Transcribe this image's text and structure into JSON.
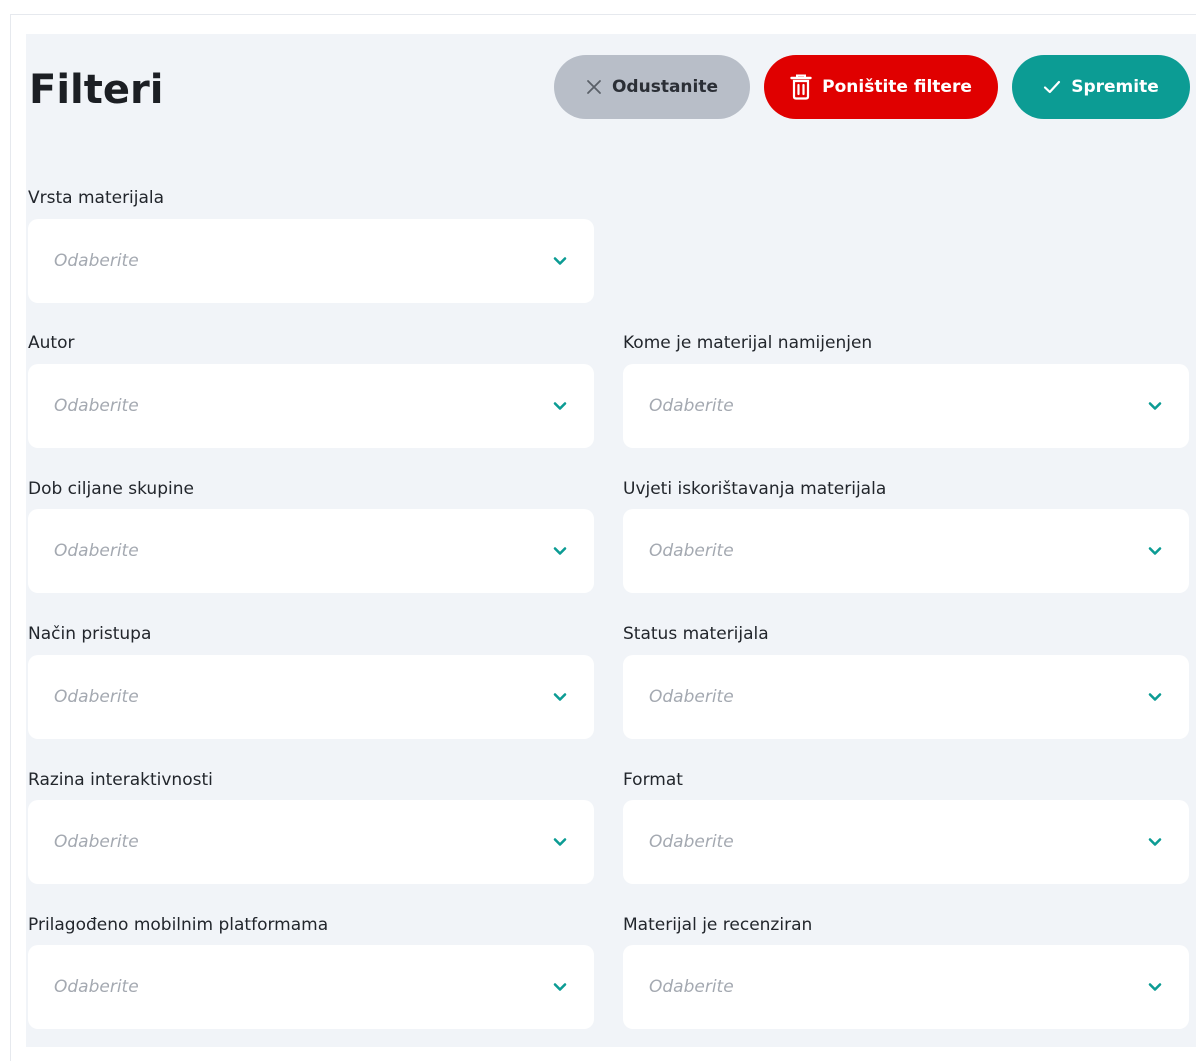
{
  "header": {
    "title": "Filteri"
  },
  "buttons": {
    "cancel": "Odustanite",
    "reset": "Poništite filtere",
    "save": "Spremite"
  },
  "colors": {
    "accent": "#0c9c94",
    "danger": "#e00000",
    "neutral_button": "#b8bec8"
  },
  "fields": [
    {
      "label": "Vrsta materijala",
      "placeholder": "Odaberite"
    },
    {
      "label": "Autor",
      "placeholder": "Odaberite"
    },
    {
      "label": "Kome je materijal namijenjen",
      "placeholder": "Odaberite"
    },
    {
      "label": "Dob ciljane skupine",
      "placeholder": "Odaberite"
    },
    {
      "label": "Uvjeti iskorištavanja materijala",
      "placeholder": "Odaberite"
    },
    {
      "label": "Način pristupa",
      "placeholder": "Odaberite"
    },
    {
      "label": "Status materijala",
      "placeholder": "Odaberite"
    },
    {
      "label": "Razina interaktivnosti",
      "placeholder": "Odaberite"
    },
    {
      "label": "Format",
      "placeholder": "Odaberite"
    },
    {
      "label": "Prilagođeno mobilnim platformama",
      "placeholder": "Odaberite"
    },
    {
      "label": "Materijal je recenziran",
      "placeholder": "Odaberite"
    }
  ],
  "icons": {
    "cancel": "close-icon",
    "reset": "trash-icon",
    "save": "check-icon",
    "dropdown": "chevron-down-icon"
  }
}
